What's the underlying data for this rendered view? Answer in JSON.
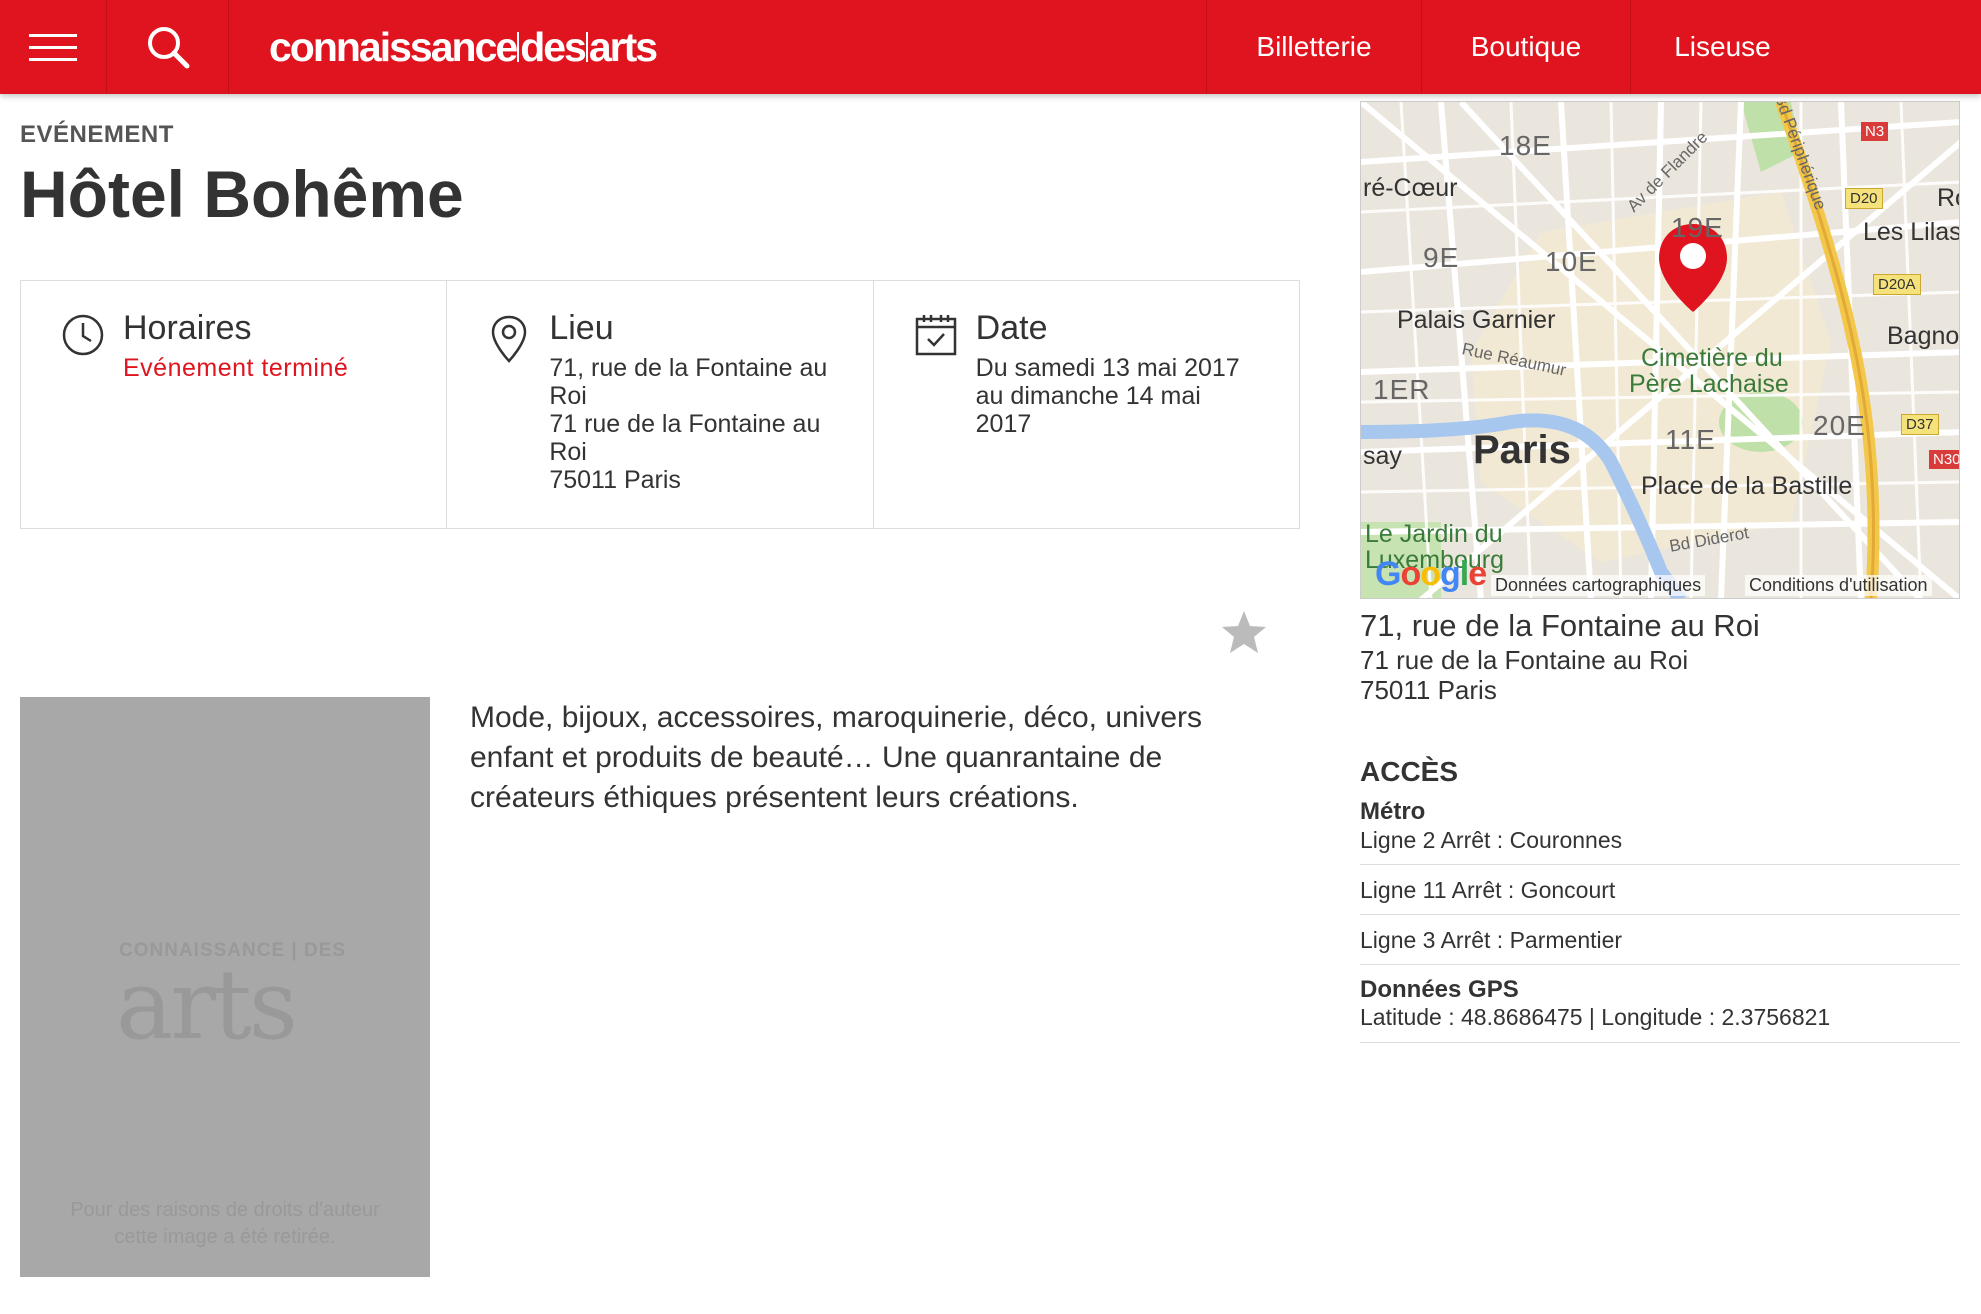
{
  "header": {
    "logo_left": "connaissance",
    "logo_mid": "des",
    "logo_right": "arts",
    "nav": [
      "Billetterie",
      "Boutique",
      "Liseuse"
    ]
  },
  "event": {
    "eyebrow": "EVÉNEMENT",
    "title": "Hôtel Bohême"
  },
  "info": {
    "hours_head": "Horaires",
    "hours_status": "Evénement terminé",
    "venue_head": "Lieu",
    "venue_lines": [
      "71, rue de la Fontaine au",
      "Roi",
      "71 rue de la Fontaine au",
      "Roi",
      "75011 Paris"
    ],
    "date_head": "Date",
    "date_lines": [
      "Du samedi 13 mai 2017",
      "au dimanche 14 mai",
      "2017"
    ]
  },
  "placeholder": {
    "logo_small": "CONNAISSANCE | DES",
    "logo_big": "arts",
    "note_1": "Pour des raisons de droits d'auteur",
    "note_2": "cette image a été retirée."
  },
  "description": "Mode, bijoux, accessoires, maroquinerie, déco, univers enfant et produits de beauté… Une quanrantaine de créateurs éthiques présentent leurs créations.",
  "map": {
    "labels": {
      "d18": "18E",
      "d19": "19E",
      "d9": "9E",
      "d10": "10E",
      "d1": "1ER",
      "d11": "11E",
      "d20": "20E",
      "sacre": "ré-Cœur",
      "garnier": "Palais Garnier",
      "paris": "Paris",
      "say": "say",
      "bastille": "Place de la Bastille",
      "cim1": "Cimetière du",
      "cim2": "Père Lachaise",
      "jardin1": "Le Jardin du",
      "jardin2": "Luxembourg",
      "lilas": "Les Lilas",
      "bagno": "Bagno",
      "ro": "Ro",
      "reaumur": "Rue Réaumur",
      "flandre": "Av de Flandre",
      "periph": "Bd Périphérique",
      "diderot": "Bd Diderot",
      "n3": "N3",
      "n30": "N30",
      "d20r": "D20",
      "d20a": "D20A",
      "d37": "D37"
    },
    "google": "Google",
    "data_credit": "Données cartographiques",
    "terms": "Conditions d'utilisation"
  },
  "address": {
    "title": "71, rue de la Fontaine au Roi",
    "line1": "71 rue de la Fontaine au Roi",
    "line2": "75011 Paris"
  },
  "access": {
    "title": "ACCÈS",
    "metro_label": "Métro",
    "lines": [
      "Ligne 2 Arrêt : Couronnes",
      "Ligne 11 Arrêt : Goncourt",
      "Ligne 3 Arrêt : Parmentier"
    ],
    "gps_label": "Données GPS",
    "gps_value": "Latitude : 48.8686475 | Longitude : 2.3756821"
  },
  "colors": {
    "brand_red": "#e0141f"
  }
}
